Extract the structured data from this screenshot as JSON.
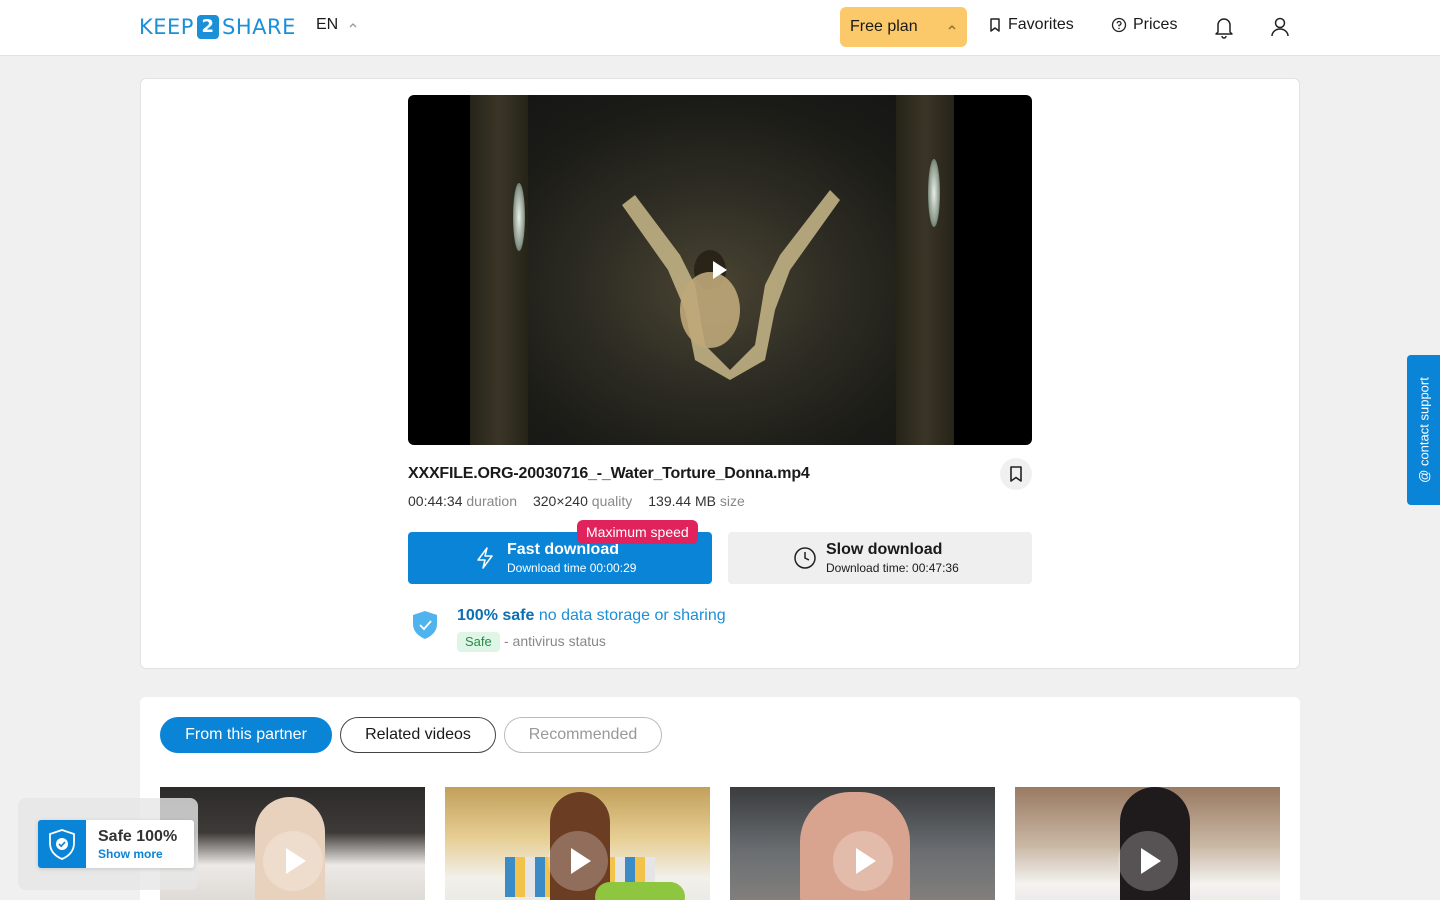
{
  "header": {
    "logo_left": "KEEP",
    "logo_num": "2",
    "logo_right": "SHARE",
    "lang": "EN",
    "plan_label": "Free plan",
    "favorites_label": "Favorites",
    "prices_label": "Prices"
  },
  "file": {
    "title": "XXXFILE.ORG-20030716_-_Water_Torture_Donna.mp4",
    "duration": "00:44:34",
    "duration_label": "duration",
    "quality": "320×240",
    "quality_label": "quality",
    "size": "139.44 MB",
    "size_label": "size"
  },
  "downloads": {
    "badge": "Maximum speed",
    "fast_title": "Fast download",
    "fast_sub": "Download time 00:00:29",
    "slow_title": "Slow download",
    "slow_sub": "Download time: 00:47:36"
  },
  "safety": {
    "bold": "100% safe",
    "rest": "no data storage or sharing",
    "tag": "Safe",
    "status": "- antivirus status"
  },
  "tabs": [
    "From this partner",
    "Related videos",
    "Recommended"
  ],
  "support_label": "@ contact support",
  "safe_popup": {
    "title": "Safe 100%",
    "link": "Show more"
  },
  "colors": {
    "accent": "#0a84d6",
    "plan": "#fbc96a",
    "badge": "#e0225d"
  }
}
